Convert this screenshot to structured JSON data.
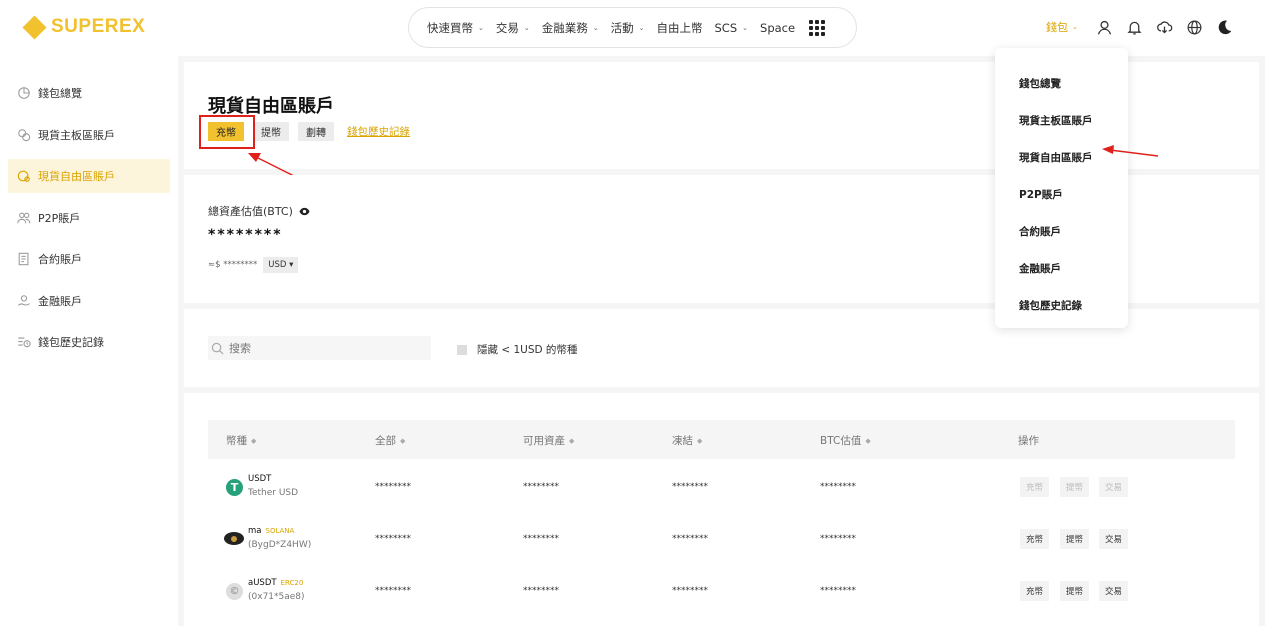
{
  "header": {
    "logo_text": "SUPEREX",
    "nav": [
      {
        "label": "快速買幣",
        "chevron": true
      },
      {
        "label": "交易",
        "chevron": true
      },
      {
        "label": "金融業務",
        "chevron": true
      },
      {
        "label": "活動",
        "chevron": true
      },
      {
        "label": "自由上幣",
        "chevron": false
      },
      {
        "label": "SCS",
        "chevron": true
      },
      {
        "label": "Space",
        "chevron": false
      }
    ],
    "wallet_label": "錢包",
    "colors": {
      "accent": "#f2c12e",
      "accent_text": "#d9a400",
      "highlight": "#e0201b"
    }
  },
  "sidebar": {
    "items": [
      {
        "label": "錢包總覽",
        "icon": "pie-chart-icon",
        "active": false
      },
      {
        "label": "現貨主板區賬戶",
        "icon": "coins-icon",
        "active": false
      },
      {
        "label": "現貨自由區賬戶",
        "icon": "wallet-coin-icon",
        "active": true
      },
      {
        "label": "P2P賬戶",
        "icon": "users-icon",
        "active": false
      },
      {
        "label": "合約賬戶",
        "icon": "contract-icon",
        "active": false
      },
      {
        "label": "金融賬戶",
        "icon": "hand-coin-icon",
        "active": false
      },
      {
        "label": "錢包歷史記錄",
        "icon": "history-list-icon",
        "active": false
      }
    ]
  },
  "main": {
    "title": "現貨自由區賬戶",
    "actions": {
      "deposit": "充幣",
      "withdraw": "提幣",
      "transfer": "劃轉",
      "history": "錢包歷史記錄"
    },
    "assets": {
      "label": "總資產估值(BTC)",
      "value": "********",
      "approx": "≈$ ********",
      "currency": "USD ▾"
    },
    "filter": {
      "search_placeholder": "搜索",
      "hide_small": "隱藏 < 1USD 的幣種"
    },
    "table": {
      "headers": [
        "幣種",
        "全部",
        "可用資產",
        "凍結",
        "BTC估值",
        "操作"
      ],
      "rows": [
        {
          "symbol": "USDT",
          "tag": "",
          "subtitle": "Tether USD",
          "icon_color": "#26a17b",
          "icon_glyph": "T",
          "total": "********",
          "available": "********",
          "frozen": "********",
          "btc": "********",
          "disabled": true
        },
        {
          "symbol": "ma",
          "tag": "SOLANA",
          "subtitle": "(BygD*Z4HW)",
          "icon_color": "#222222",
          "icon_glyph": "",
          "total": "********",
          "available": "********",
          "frozen": "********",
          "btc": "********",
          "disabled": false
        },
        {
          "symbol": "aUSDT",
          "tag": "ERC20",
          "subtitle": "(0x71*5ae8)",
          "icon_color": "#dddddd",
          "icon_glyph": "©",
          "total": "********",
          "available": "********",
          "frozen": "********",
          "btc": "********",
          "disabled": false
        }
      ],
      "row_actions": {
        "deposit": "充幣",
        "withdraw": "提幣",
        "trade": "交易"
      }
    }
  },
  "dropdown": {
    "items": [
      "錢包總覽",
      "現貨主板區賬戶",
      "現貨自由區賬戶",
      "P2P賬戶",
      "合約賬戶",
      "金融賬戶",
      "錢包歷史記錄"
    ]
  }
}
